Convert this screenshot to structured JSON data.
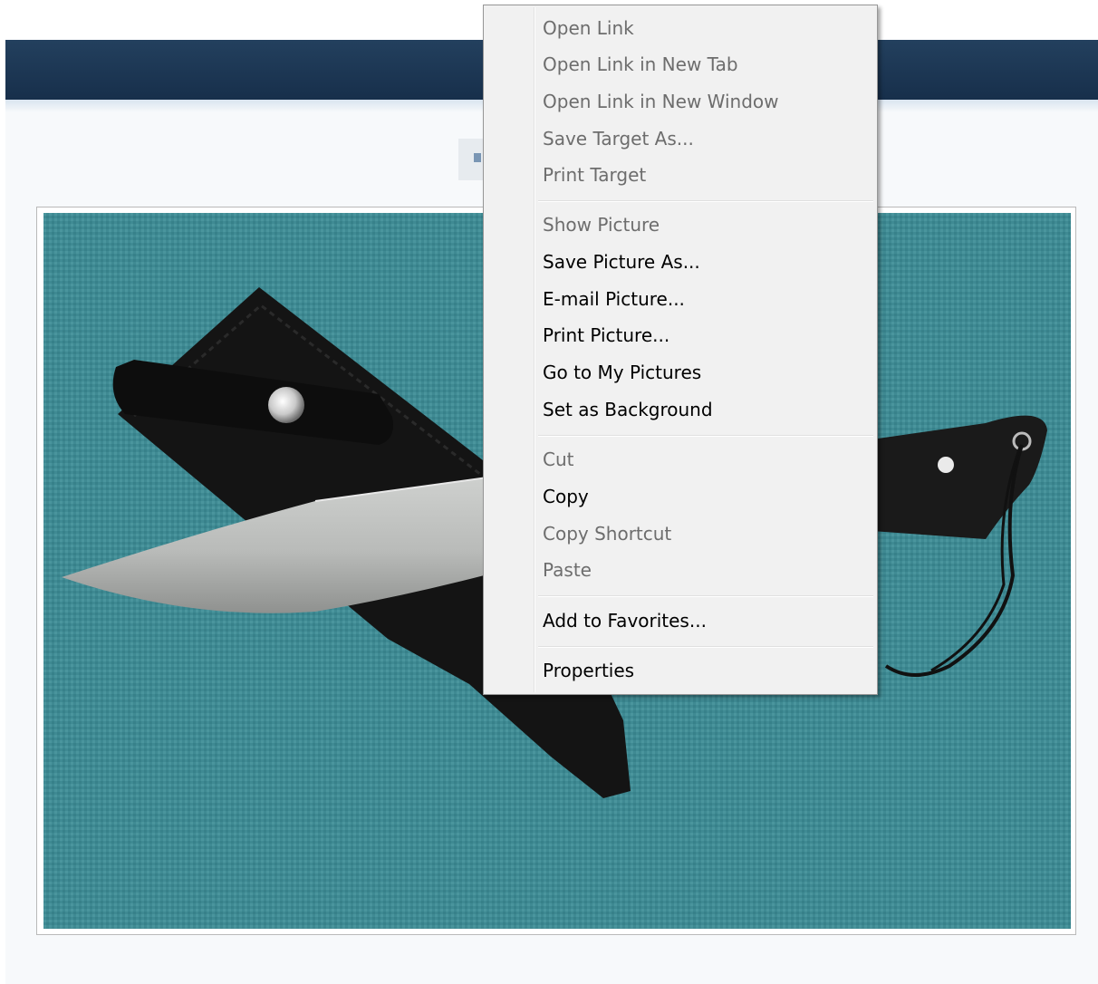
{
  "context_menu": {
    "groups": [
      [
        {
          "label": "Open Link",
          "enabled": false
        },
        {
          "label": "Open Link in New Tab",
          "enabled": false
        },
        {
          "label": "Open Link in New Window",
          "enabled": false
        },
        {
          "label": "Save Target As...",
          "enabled": false
        },
        {
          "label": "Print Target",
          "enabled": false
        }
      ],
      [
        {
          "label": "Show Picture",
          "enabled": false
        },
        {
          "label": "Save Picture As...",
          "enabled": true
        },
        {
          "label": "E-mail Picture...",
          "enabled": true
        },
        {
          "label": "Print Picture...",
          "enabled": true
        },
        {
          "label": "Go to My Pictures",
          "enabled": true
        },
        {
          "label": "Set as Background",
          "enabled": true
        }
      ],
      [
        {
          "label": "Cut",
          "enabled": false
        },
        {
          "label": "Copy",
          "enabled": true
        },
        {
          "label": "Copy Shortcut",
          "enabled": false
        },
        {
          "label": "Paste",
          "enabled": false
        }
      ],
      [
        {
          "label": "Add to Favorites...",
          "enabled": true
        }
      ],
      [
        {
          "label": "Properties",
          "enabled": true
        }
      ]
    ]
  },
  "colors": {
    "nav_bar": "#1b3552",
    "page_background": "#f7f9fb",
    "menu_background": "#f1f1f1",
    "photo_background": "#3f8a93"
  }
}
